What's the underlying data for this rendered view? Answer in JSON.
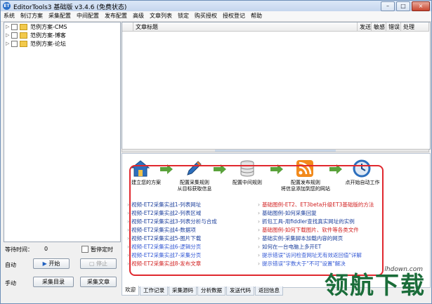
{
  "window": {
    "title": "EditorTools3 基础版 v3.4.6 (免费状态)",
    "app_icon": "ET",
    "buttons": {
      "min": "–",
      "max": "□",
      "close": "×"
    }
  },
  "menu": [
    "系统",
    "制订方案",
    "采集配置",
    "中间配置",
    "发布配置",
    "高级",
    "文章列表",
    "锁定",
    "购买授权",
    "授权登记",
    "帮助"
  ],
  "tree": [
    {
      "label": "范例方案-CMS"
    },
    {
      "label": "范例方案-博客"
    },
    {
      "label": "范例方案-论坛"
    }
  ],
  "grid": {
    "columns": [
      "文章标题",
      "发送",
      "敏感",
      "错误",
      "处理"
    ]
  },
  "flow": [
    {
      "icon": "home-icon",
      "label1": "建立您的方案",
      "label2": ""
    },
    {
      "icon": "pencil-icon",
      "label1": "配置采集规则",
      "label2": "从目标获取信息"
    },
    {
      "icon": "database-icon",
      "label1": "配置中间规则",
      "label2": ""
    },
    {
      "icon": "rss-icon",
      "label1": "配置发布规则",
      "label2": "将信息添加到您的网站"
    },
    {
      "icon": "clock-icon",
      "label1": "点开始自动工作",
      "label2": ""
    }
  ],
  "links_left": [
    {
      "text": "视频-ET2采集实战1-列表网址",
      "color": "#1c3f9c"
    },
    {
      "text": "视频-ET2采集实战2-列表区域",
      "color": "#1c3f9c"
    },
    {
      "text": "视频-ET2采集实战3-列表分析与合成",
      "color": "#1c3f9c"
    },
    {
      "text": "视频-ET2采集实战4-数据项",
      "color": "#1c3f9c"
    },
    {
      "text": "视频-ET2采集实战5-图片下载",
      "color": "#1c3f9c"
    },
    {
      "text": "视频-ET2采集实战6-逻辑分页",
      "color": "#3358d4"
    },
    {
      "text": "视频-ET2采集实战7-采集分页",
      "color": "#3358d4"
    },
    {
      "text": "视频-ET2采集实战8-发布文章",
      "color": "#d22222"
    }
  ],
  "links_right": [
    {
      "text": "基础图例-ET2、ET3beta升级ET3基础版的方法",
      "color": "#d22222"
    },
    {
      "text": "基础图例-如何采集回复",
      "color": "#1c3f9c"
    },
    {
      "text": "抓包工具-用fiddler查找真实网址的实例",
      "color": "#1c3f9c"
    },
    {
      "text": "基础图例-如何下载图片、软件等各类文件",
      "color": "#d22222"
    },
    {
      "text": "基础实例-采集脚本加载内容的网页",
      "color": "#1c3f9c"
    },
    {
      "text": "如何在一台电脑上多开ET",
      "color": "#1c3f9c"
    },
    {
      "text": "提示错误\"访问检查网址无有效返回值\"详解",
      "color": "#3358d4"
    },
    {
      "text": "提示错误\"字数大于\"不可\"设置\"解决",
      "color": "#3358d4"
    }
  ],
  "tabs": [
    "欢迎",
    "工作记录",
    "采集源码",
    "分析数据",
    "发送代码",
    "返回信息"
  ],
  "controls": {
    "wait_label": "等待时间：",
    "wait_value": "0",
    "pause_label": "暂停定时",
    "auto_label": "自动",
    "start_button": "开始",
    "stop_button": "停止",
    "manual_label": "手动",
    "collect_button": "采集目录",
    "collect_article_button": "采集文章"
  },
  "watermark": {
    "cn": "领航下载",
    "site": "lhdown.com"
  },
  "colors": {
    "accent_red": "#e0282e",
    "link_blue": "#1c3f9c",
    "link_red": "#d22222"
  }
}
